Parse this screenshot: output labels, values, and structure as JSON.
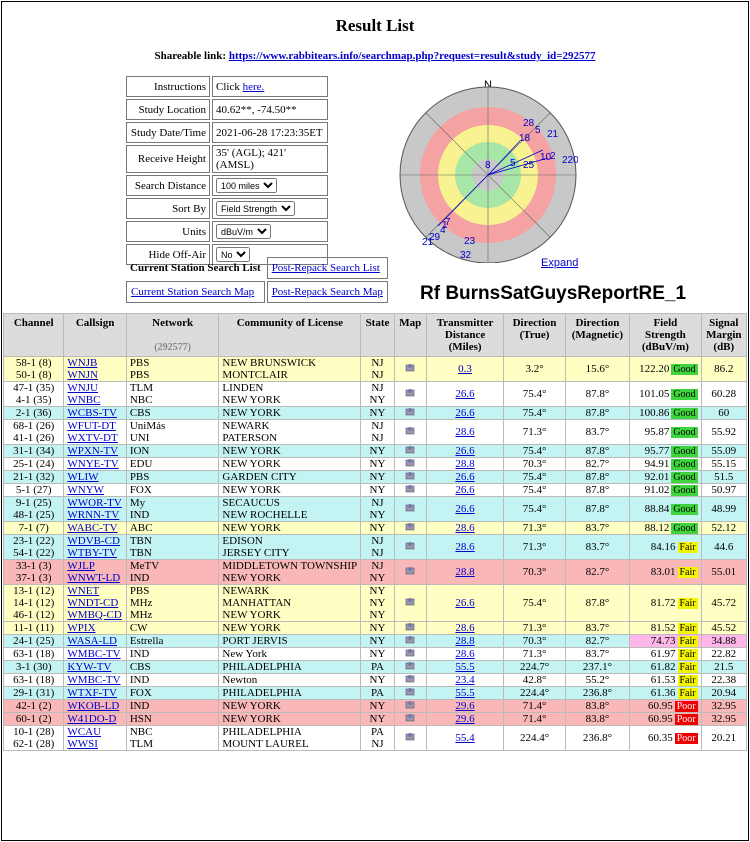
{
  "title": "Result List",
  "share": {
    "label": "Shareable link:",
    "url": "https://www.rabbitears.info/searchmap.php?request=result&study_id=292577"
  },
  "params": [
    {
      "label": "Instructions",
      "value": "Click ",
      "link": "here."
    },
    {
      "label": "Study Location",
      "value": "40.62**, -74.50**"
    },
    {
      "label": "Study Date/Time",
      "value": "2021-06-28 17:23:35ET"
    },
    {
      "label": "Receive Height",
      "value": "35' (AGL); 421' (AMSL)"
    },
    {
      "label": "Search Distance",
      "select": "100 miles"
    },
    {
      "label": "Sort By",
      "select": "Field Strength"
    },
    {
      "label": "Units",
      "select": "dBuV/m"
    },
    {
      "label": "Hide Off-Air",
      "select": "No"
    }
  ],
  "lists": {
    "current_list": "Current Station Search List",
    "post_list": "Post-Repack Search List",
    "current_map": "Current Station Search Map",
    "post_map": "Post-Repack Search Map"
  },
  "radar": {
    "north": "N",
    "expand": "Expand",
    "labels": [
      "28",
      "5",
      "21",
      "18",
      "2",
      "10",
      "220",
      "8",
      "5",
      "25",
      "7",
      "29",
      "21",
      "4",
      "1",
      "23",
      "32"
    ],
    "colors": {
      "outer": "#c8c8c8",
      "red": "#f5a2a2",
      "yellow": "#f8f290",
      "green": "#a8e6a8"
    }
  },
  "report_title": "Rf BurnsSatGuysReportRE_1",
  "headers": {
    "channel": "Channel",
    "callsign": "Callsign",
    "network": "Network",
    "network_id": "(292577)",
    "community": "Community of License",
    "state": "State",
    "map": "Map",
    "distance": "Transmitter Distance (Miles)",
    "dir_true": "Direction (True)",
    "dir_mag": "Direction (Magnetic)",
    "field": "Field Strength (dBuV/m)",
    "margin": "Signal Margin (dB)"
  },
  "rows": [
    {
      "cls": "r-yellow",
      "ch": [
        "58-1 (8)",
        "50-1 (8)"
      ],
      "call": [
        "WNJB",
        "WNJN"
      ],
      "net": [
        "PBS",
        "PBS"
      ],
      "comm": [
        "NEW BRUNSWICK",
        "MONTCLAIR"
      ],
      "st": [
        "NJ",
        "NJ"
      ],
      "dist": "0.3",
      "dt": "3.2°",
      "dm": "15.6°",
      "fs": "122.20",
      "q": "Good",
      "sm": "86.2"
    },
    {
      "cls": "r-white",
      "ch": [
        "47-1 (35)",
        "4-1 (35)"
      ],
      "call": [
        "WNJU",
        "WNBC"
      ],
      "net": [
        "TLM",
        "NBC"
      ],
      "comm": [
        "LINDEN",
        "NEW YORK"
      ],
      "st": [
        "NJ",
        "NY"
      ],
      "dist": "26.6",
      "dt": "75.4°",
      "dm": "87.8°",
      "fs": "101.05",
      "q": "Good",
      "sm": "60.28"
    },
    {
      "cls": "r-green",
      "ch": [
        "2-1 (36)"
      ],
      "call": [
        "WCBS-TV"
      ],
      "net": [
        "CBS"
      ],
      "comm": [
        "NEW YORK"
      ],
      "st": [
        "NY"
      ],
      "dist": "26.6",
      "dt": "75.4°",
      "dm": "87.8°",
      "fs": "100.86",
      "q": "Good",
      "sm": "60"
    },
    {
      "cls": "r-white",
      "ch": [
        "68-1 (26)",
        "41-1 (26)"
      ],
      "call": [
        "WFUT-DT",
        "WXTV-DT"
      ],
      "net": [
        "UniMás",
        "UNI"
      ],
      "comm": [
        "NEWARK",
        "PATERSON"
      ],
      "st": [
        "NJ",
        "NJ"
      ],
      "dist": "28.6",
      "dt": "71.3°",
      "dm": "83.7°",
      "fs": "95.87",
      "q": "Good",
      "sm": "55.92"
    },
    {
      "cls": "r-green",
      "ch": [
        "31-1 (34)"
      ],
      "call": [
        "WPXN-TV"
      ],
      "net": [
        "ION"
      ],
      "comm": [
        "NEW YORK"
      ],
      "st": [
        "NY"
      ],
      "dist": "26.6",
      "dt": "75.4°",
      "dm": "87.8°",
      "fs": "95.77",
      "q": "Good",
      "sm": "55.09"
    },
    {
      "cls": "r-white",
      "ch": [
        "25-1 (24)"
      ],
      "call": [
        "WNYE-TV"
      ],
      "net": [
        "EDU"
      ],
      "comm": [
        "NEW YORK"
      ],
      "st": [
        "NY"
      ],
      "dist": "28.8",
      "dt": "70.3°",
      "dm": "82.7°",
      "fs": "94.91",
      "q": "Good",
      "sm": "55.15"
    },
    {
      "cls": "r-green",
      "ch": [
        "21-1 (32)"
      ],
      "call": [
        "WLIW"
      ],
      "net": [
        "PBS"
      ],
      "comm": [
        "GARDEN CITY"
      ],
      "st": [
        "NY"
      ],
      "dist": "26.6",
      "dt": "75.4°",
      "dm": "87.8°",
      "fs": "92.01",
      "q": "Good",
      "sm": "51.5"
    },
    {
      "cls": "r-white",
      "ch": [
        "5-1 (27)"
      ],
      "call": [
        "WNYW"
      ],
      "net": [
        "FOX"
      ],
      "comm": [
        "NEW YORK"
      ],
      "st": [
        "NY"
      ],
      "dist": "26.6",
      "dt": "75.4°",
      "dm": "87.8°",
      "fs": "91.02",
      "q": "Good",
      "sm": "50.97"
    },
    {
      "cls": "r-green",
      "ch": [
        "9-1 (25)",
        "48-1 (25)"
      ],
      "call": [
        "WWOR-TV",
        "WRNN-TV"
      ],
      "net": [
        "My",
        "IND"
      ],
      "comm": [
        "SECAUCUS",
        "NEW ROCHELLE"
      ],
      "st": [
        "NJ",
        "NY"
      ],
      "dist": "26.6",
      "dt": "75.4°",
      "dm": "87.8°",
      "fs": "88.84",
      "q": "Good",
      "sm": "48.99"
    },
    {
      "cls": "r-yellow",
      "ch": [
        "7-1 (7)"
      ],
      "call": [
        "WABC-TV"
      ],
      "net": [
        "ABC"
      ],
      "comm": [
        "NEW YORK"
      ],
      "st": [
        "NY"
      ],
      "dist": "28.6",
      "dt": "71.3°",
      "dm": "83.7°",
      "fs": "88.12",
      "q": "Good",
      "sm": "52.12"
    },
    {
      "cls": "r-green",
      "ch": [
        "23-1 (22)",
        "54-1 (22)"
      ],
      "call": [
        "WDVB-CD",
        "WTBY-TV"
      ],
      "net": [
        "TBN",
        "TBN"
      ],
      "comm": [
        "EDISON",
        "JERSEY CITY"
      ],
      "st": [
        "NJ",
        "NJ"
      ],
      "dist": "28.6",
      "dt": "71.3°",
      "dm": "83.7°",
      "fs": "84.16",
      "q": "Fair",
      "sm": "44.6"
    },
    {
      "cls": "r-red",
      "ch": [
        "33-1 (3)",
        "37-1 (3)"
      ],
      "call": [
        "WJLP",
        "WNWT-LD"
      ],
      "net": [
        "MeTV",
        "IND"
      ],
      "comm": [
        "MIDDLETOWN TOWNSHIP",
        "NEW YORK"
      ],
      "st": [
        "NJ",
        "NY"
      ],
      "dist": "28.8",
      "dt": "70.3°",
      "dm": "82.7°",
      "fs": "83.01",
      "q": "Fair",
      "sm": "55.01"
    },
    {
      "cls": "r-yellow",
      "ch": [
        "13-1 (12)",
        "14-1 (12)",
        "46-1 (12)"
      ],
      "call": [
        "WNET",
        "WNDT-CD",
        "WMBQ-CD"
      ],
      "net": [
        "PBS",
        "MHz",
        "MHz"
      ],
      "comm": [
        "NEWARK",
        "MANHATTAN",
        "NEW YORK"
      ],
      "st": [
        "NY",
        "NY",
        "NY"
      ],
      "dist": "26.6",
      "dt": "75.4°",
      "dm": "87.8°",
      "fs": "81.72",
      "q": "Fair",
      "sm": "45.72"
    },
    {
      "cls": "r-yellow",
      "ch": [
        "11-1 (11)"
      ],
      "call": [
        "WPIX"
      ],
      "net": [
        "CW"
      ],
      "comm": [
        "NEW YORK"
      ],
      "st": [
        "NY"
      ],
      "dist": "28.6",
      "dt": "71.3°",
      "dm": "83.7°",
      "fs": "81.52",
      "q": "Fair",
      "sm": "45.52"
    },
    {
      "cls": "r-green",
      "ch": [
        "24-1 (25)"
      ],
      "call": [
        "WASA-LD"
      ],
      "net": [
        "Estrella"
      ],
      "comm": [
        "PORT JERVIS"
      ],
      "st": [
        "NY"
      ],
      "dist": "28.8",
      "dt": "70.3°",
      "dm": "82.7°",
      "fs": "74.73",
      "q": "Fair",
      "sm": "34.88",
      "pink": true
    },
    {
      "cls": "r-white",
      "ch": [
        "63-1 (18)"
      ],
      "call": [
        "WMBC-TV"
      ],
      "net": [
        "IND"
      ],
      "comm": [
        "New York"
      ],
      "st": [
        "NY"
      ],
      "dist": "28.6",
      "dt": "71.3°",
      "dm": "83.7°",
      "fs": "61.97",
      "q": "Fair",
      "sm": "22.82"
    },
    {
      "cls": "r-green",
      "ch": [
        "3-1 (30)"
      ],
      "call": [
        "KYW-TV"
      ],
      "net": [
        "CBS"
      ],
      "comm": [
        "PHILADELPHIA"
      ],
      "st": [
        "PA"
      ],
      "dist": "55.5",
      "dt": "224.7°",
      "dm": "237.1°",
      "fs": "61.82",
      "q": "Fair",
      "sm": "21.5"
    },
    {
      "cls": "r-white",
      "ch": [
        "63-1 (18)"
      ],
      "call": [
        "WMBC-TV"
      ],
      "net": [
        "IND"
      ],
      "comm": [
        "Newton"
      ],
      "st": [
        "NY"
      ],
      "dist": "23.4",
      "dt": "42.8°",
      "dm": "55.2°",
      "fs": "61.53",
      "q": "Fair",
      "sm": "22.38"
    },
    {
      "cls": "r-green",
      "ch": [
        "29-1 (31)"
      ],
      "call": [
        "WTXF-TV"
      ],
      "net": [
        "FOX"
      ],
      "comm": [
        "PHILADELPHIA"
      ],
      "st": [
        "PA"
      ],
      "dist": "55.5",
      "dt": "224.4°",
      "dm": "236.8°",
      "fs": "61.36",
      "q": "Fair",
      "sm": "20.94"
    },
    {
      "cls": "r-red",
      "ch": [
        "42-1 (2)"
      ],
      "call": [
        "WKOB-LD"
      ],
      "net": [
        "IND"
      ],
      "comm": [
        "NEW YORK"
      ],
      "st": [
        "NY"
      ],
      "dist": "29.6",
      "dt": "71.4°",
      "dm": "83.8°",
      "fs": "60.95",
      "q": "Poor",
      "sm": "32.95"
    },
    {
      "cls": "r-red",
      "ch": [
        "60-1 (2)"
      ],
      "call": [
        "W41DO-D"
      ],
      "net": [
        "HSN"
      ],
      "comm": [
        "NEW YORK"
      ],
      "st": [
        "NY"
      ],
      "dist": "29.6",
      "dt": "71.4°",
      "dm": "83.8°",
      "fs": "60.95",
      "q": "Poor",
      "sm": "32.95"
    },
    {
      "cls": "r-white",
      "ch": [
        "10-1 (28)",
        "62-1 (28)"
      ],
      "call": [
        "WCAU",
        "WWSI"
      ],
      "net": [
        "NBC",
        "TLM"
      ],
      "comm": [
        "PHILADELPHIA",
        "MOUNT LAUREL"
      ],
      "st": [
        "PA",
        "NJ"
      ],
      "dist": "55.4",
      "dt": "224.4°",
      "dm": "236.8°",
      "fs": "60.35",
      "q": "Poor",
      "sm": "20.21"
    }
  ]
}
